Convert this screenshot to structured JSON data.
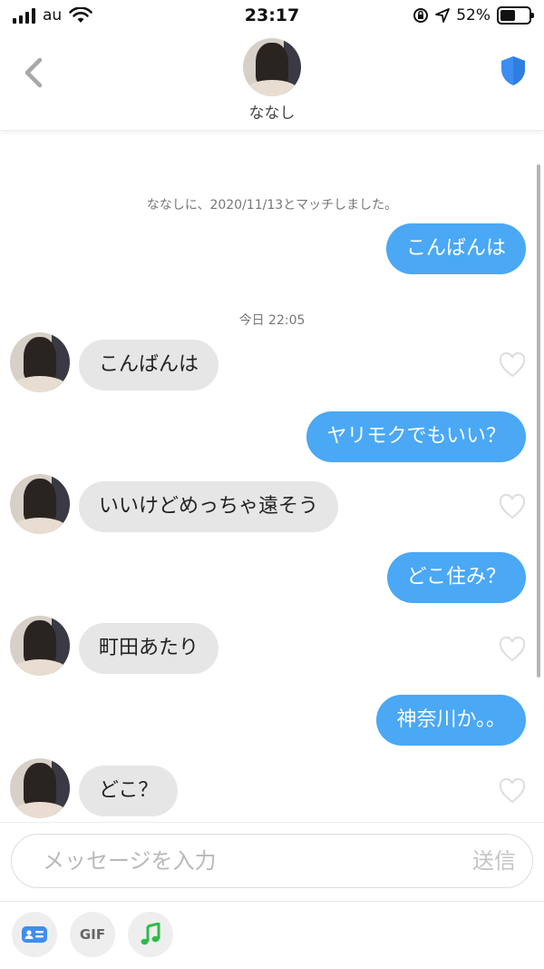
{
  "status_bar": {
    "carrier": "au",
    "time": "23:17",
    "battery": "52%",
    "battery_level": 0.52
  },
  "header": {
    "name": "ななし",
    "back_icon": "chevron-left-icon",
    "safety_icon": "shield-icon",
    "accent_color": "#4aa8f5"
  },
  "chat": {
    "match_notice": "ななしに、2020/11/13とマッチしました。",
    "timestamp": "今日 22:05",
    "messages": [
      {
        "from": "me",
        "text": "こんばんは"
      },
      {
        "from": "them",
        "text": "こんばんは"
      },
      {
        "from": "me",
        "text": "ヤリモクでもいい？"
      },
      {
        "from": "them",
        "text": "いいけどめっちゃ遠そう"
      },
      {
        "from": "me",
        "text": "どこ住み？"
      },
      {
        "from": "them",
        "text": "町田あたり"
      },
      {
        "from": "me",
        "text": "神奈川か。。"
      },
      {
        "from": "them",
        "text": "どこ？"
      }
    ]
  },
  "composer": {
    "placeholder": "メッセージを入力",
    "send_label": "送信",
    "tools": {
      "card_icon": "contact-card-icon",
      "gif_label": "GIF",
      "music_icon": "music-note-icon"
    }
  }
}
